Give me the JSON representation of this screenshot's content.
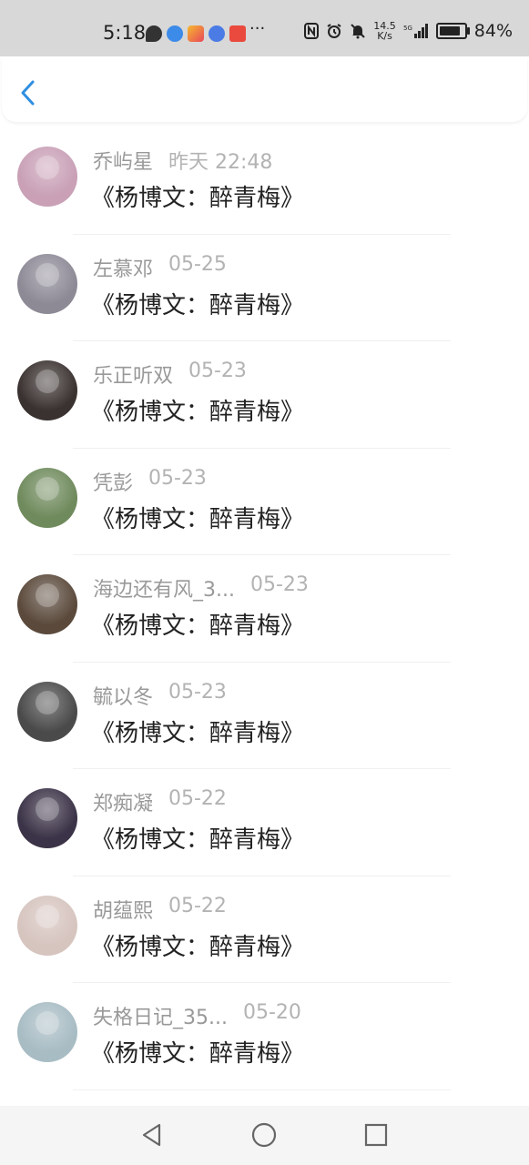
{
  "status_bar": {
    "time": "5:18",
    "overflow": "···",
    "speed_top": "14.5",
    "speed_bottom": "K/s",
    "network": "5G",
    "battery": "84%",
    "battery_level": 0.84
  },
  "header": {
    "back_icon": "chevron-left-icon"
  },
  "messages": [
    {
      "name": "乔屿星",
      "date": "昨天 22:48",
      "message": "《杨博文：醉青梅》",
      "avatar_color": "#c9a0b6"
    },
    {
      "name": "左慕邓",
      "date": "05-25",
      "message": "《杨博文：醉青梅》",
      "avatar_color": "#8d8a96"
    },
    {
      "name": "乐正听双",
      "date": "05-23",
      "message": "《杨博文：醉青梅》",
      "avatar_color": "#3a3230"
    },
    {
      "name": "凭彭",
      "date": "05-23",
      "message": "《杨博文：醉青梅》",
      "avatar_color": "#6f8a5c"
    },
    {
      "name": "海边还有风_3...",
      "date": "05-23",
      "message": "《杨博文：醉青梅》",
      "avatar_color": "#5b4a3c"
    },
    {
      "name": "毓以冬",
      "date": "05-23",
      "message": "《杨博文：醉青梅》",
      "avatar_color": "#4a4a4a"
    },
    {
      "name": "郑痴凝",
      "date": "05-22",
      "message": "《杨博文：醉青梅》",
      "avatar_color": "#3b3347"
    },
    {
      "name": "胡蕴熙",
      "date": "05-22",
      "message": "《杨博文：醉青梅》",
      "avatar_color": "#d6c4bf"
    },
    {
      "name": "失格日记_35...",
      "date": "05-20",
      "message": "《杨博文：醉青梅》",
      "avatar_color": "#a8bcc4"
    }
  ],
  "nav_bar": {
    "back": "triangle-back-icon",
    "home": "circle-home-icon",
    "recents": "square-recents-icon"
  }
}
